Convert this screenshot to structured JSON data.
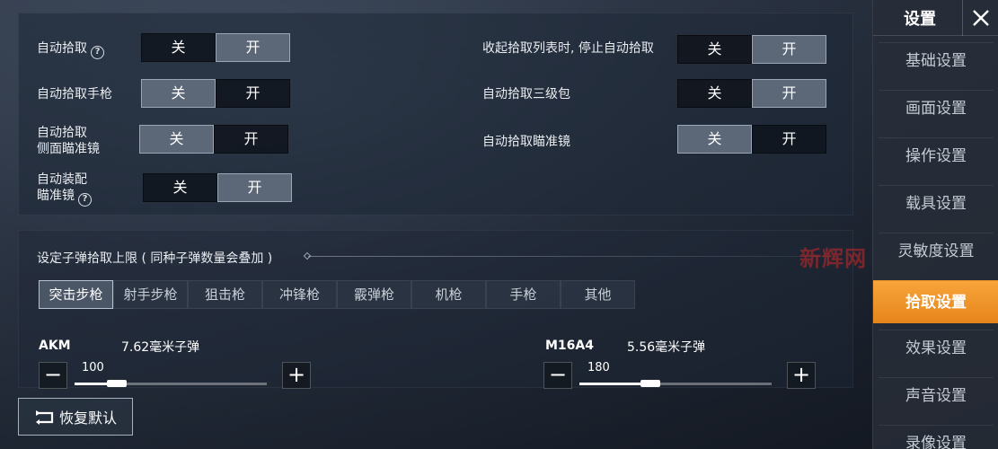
{
  "settings": {
    "left": [
      {
        "label": "自动拾取",
        "help": true,
        "off": "关",
        "on": "开",
        "state": "on"
      },
      {
        "label": "自动拾取手枪",
        "help": false,
        "off": "关",
        "on": "开",
        "state": "off"
      },
      {
        "label_line1": "自动拾取",
        "label_line2": "侧面瞄准镜",
        "help": false,
        "off": "关",
        "on": "开",
        "state": "off"
      },
      {
        "label_line1": "自动装配",
        "label_line2": "瞄准镜",
        "help": true,
        "off": "关",
        "on": "开",
        "state": "on"
      }
    ],
    "right": [
      {
        "label": "收起拾取列表时, 停止自动拾取",
        "off": "关",
        "on": "开",
        "state": "on"
      },
      {
        "label": "自动拾取三级包",
        "off": "关",
        "on": "开",
        "state": "on"
      },
      {
        "label": "自动拾取瞄准镜",
        "off": "关",
        "on": "开",
        "state": "off"
      }
    ]
  },
  "ammo_section": {
    "title": "设定子弹拾取上限 ( 同种子弹数量会叠加 )",
    "tabs": [
      "突击步枪",
      "射手步枪",
      "狙击枪",
      "冲锋枪",
      "霰弹枪",
      "机枪",
      "手枪",
      "其他"
    ],
    "active_tab": 0,
    "guns": [
      {
        "name": "AKM",
        "ammo": "7.62毫米子弹",
        "value": "100",
        "fraction": 0.22
      },
      {
        "name": "M16A4",
        "ammo": "5.56毫米子弹",
        "value": "180",
        "fraction": 0.37
      }
    ]
  },
  "restore": {
    "label": "恢复默认",
    "icon": "restore-icon"
  },
  "sidebar": {
    "title": "设置",
    "items": [
      "基础设置",
      "画面设置",
      "操作设置",
      "载具设置",
      "灵敏度设置",
      "拾取设置",
      "效果设置",
      "声音设置",
      "录像设置"
    ],
    "active": 5
  },
  "watermark": "新辉网",
  "colors": {
    "accent": "#f0962a",
    "toggle_on": "#5c6878",
    "toggle_off": "#0f141c"
  }
}
